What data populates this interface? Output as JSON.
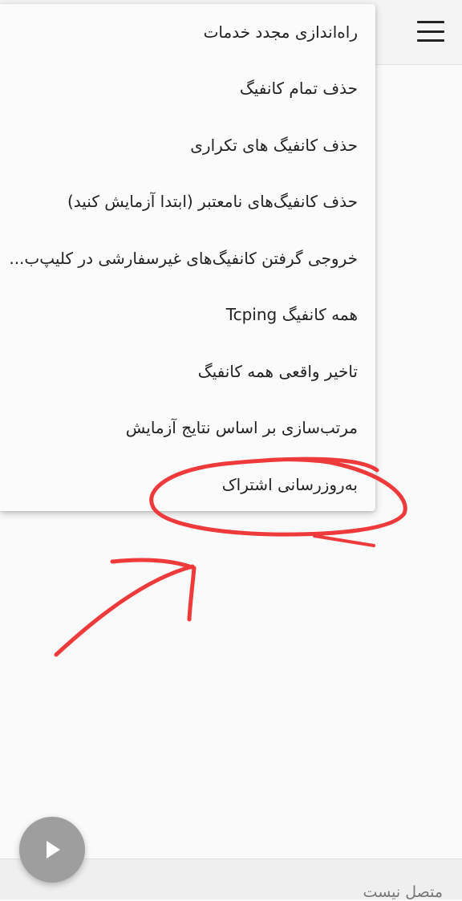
{
  "header": {
    "menu_icon": "hamburger-icon"
  },
  "overflow_menu": {
    "items": [
      {
        "label": "راه‌اندازی مجدد خدمات"
      },
      {
        "label": "حذف تمام کانفیگ"
      },
      {
        "label": "حذف کانفیگ های تکراری"
      },
      {
        "label": "حذف کانفیگ‌های نامعتبر (ابتدا آزمایش کنید)"
      },
      {
        "label": "خروجی گرفتن کانفیگ‌های غیرسفارشی در کلیپ‌ب..."
      },
      {
        "label": "همه کانفیگ Tcping"
      },
      {
        "label": "تاخیر واقعی همه کانفیگ"
      },
      {
        "label": "مرتب‌سازی بر اساس نتایج آزمایش"
      },
      {
        "label": "به‌روزرسانی اشتراک"
      }
    ]
  },
  "fab": {
    "icon": "play-icon",
    "color": "#9e9e9e"
  },
  "status": {
    "text": "متصل نیست"
  },
  "annotation": {
    "color": "#ee3a3a",
    "highlighted_item": "به‌روزرسانی اشتراک"
  }
}
